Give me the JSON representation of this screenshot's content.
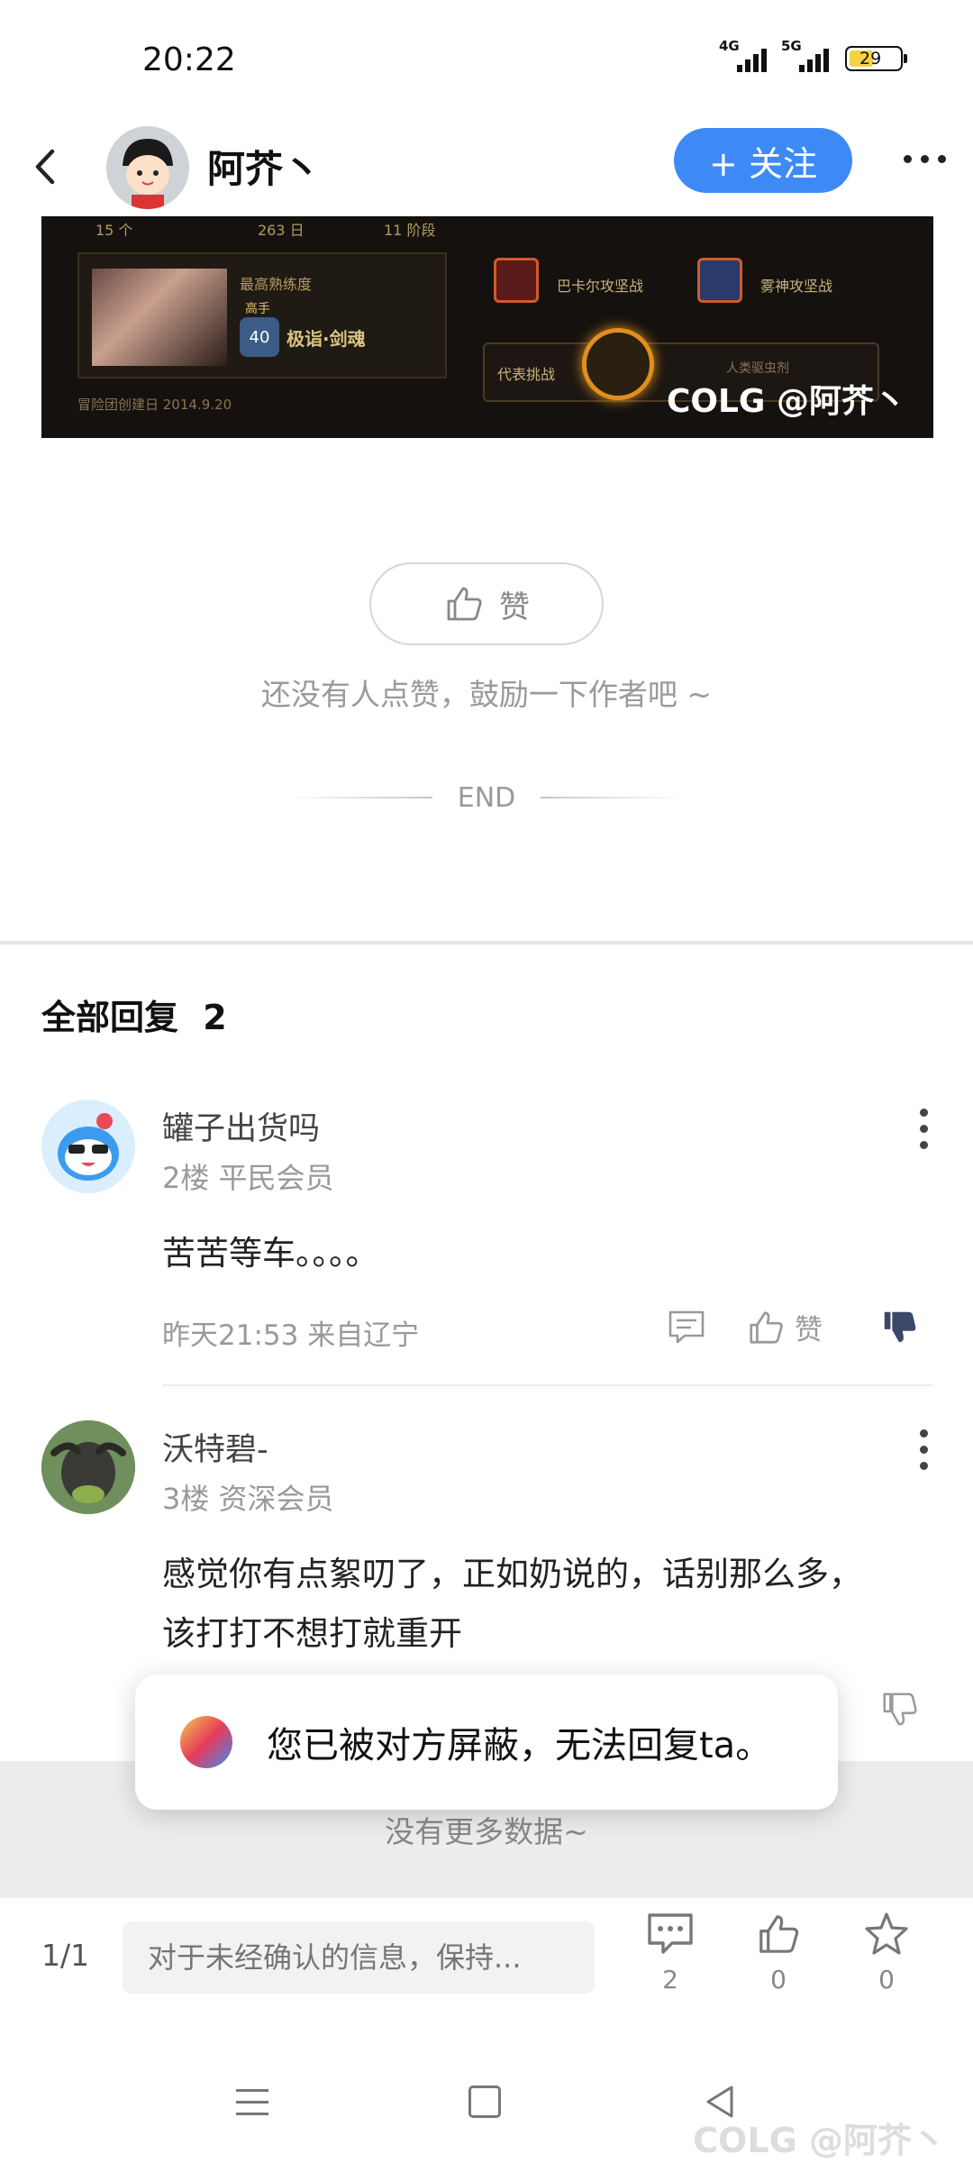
{
  "status_bar": {
    "time": "20:22",
    "signal_1_label": "4G",
    "signal_2_label": "5G",
    "battery": "29"
  },
  "header": {
    "author_name": "阿芥丶",
    "follow_label": "+ 关注"
  },
  "game_image": {
    "stat_1": "15 个",
    "stat_2": "263 日",
    "stat_3": "11 阶段",
    "mastery_label": "最高熟练度",
    "rank_label": "高手",
    "level": "40",
    "skill_title": "极诣·剑魂",
    "created_label": "冒险团创建日 2014.9.20",
    "boss_1": "巴卡尔攻坚战",
    "boss_2": "雾神攻坚战",
    "challenge_label": "代表挑战",
    "challenge_sub": "人类驱虫剂",
    "watermark": "COLG @阿芥丶"
  },
  "like": {
    "button_label": "赞",
    "hint": "还没有人点赞，鼓励一下作者吧 ~",
    "end_label": "END"
  },
  "replies": {
    "title": "全部回复",
    "count": "2",
    "items": [
      {
        "name": "罐子出货吗",
        "meta": "2楼 平民会员",
        "text": "苦苦等车。。。。",
        "time": "昨天21:53 来自辽宁",
        "like_label": "赞"
      },
      {
        "name": "沃特碧-",
        "meta": "3楼 资深会员",
        "text_line_1": "感觉你有点絮叨了，正如奶说的，话别那么多，",
        "text_line_2": "该打打不想打就重开"
      }
    ]
  },
  "toast": {
    "message": "您已被对方屏蔽，无法回复ta。"
  },
  "no_more": "没有更多数据~",
  "bottom_bar": {
    "pager": "1/1",
    "input_placeholder": "对于未经确认的信息，保持...",
    "comment_count": "2",
    "like_count": "0",
    "fav_count": "0"
  },
  "nav": {
    "watermark": "COLG @阿芥丶"
  },
  "colors": {
    "accent": "#3d8af7",
    "dislike_active": "#3a4a66"
  }
}
